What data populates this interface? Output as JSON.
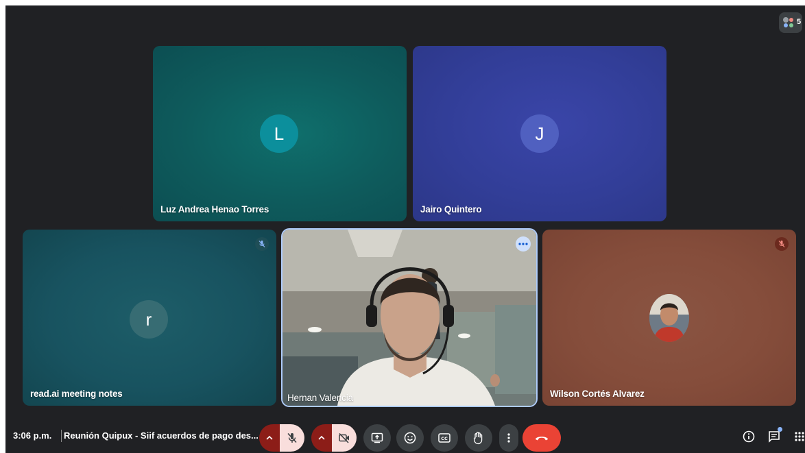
{
  "participants": {
    "count": "5",
    "tiles": [
      {
        "name": "Luz Andrea Henao Torres",
        "initial": "L"
      },
      {
        "name": "Jairo Quintero",
        "initial": "J"
      },
      {
        "name": "read.ai meeting notes",
        "initial": "r"
      },
      {
        "name": "Hernan Valencia"
      },
      {
        "name": "Wilson Cortés Alvarez"
      }
    ]
  },
  "bottom_bar": {
    "time": "3:06 p.m.",
    "meeting_title": "Reunión Quipux - Siif acuerdos de pago des..."
  },
  "colors": {
    "stage": "#202124",
    "teal_tile": "#0f5c5c",
    "blue_tile": "#33409a",
    "dark_teal_tile": "#174f5b",
    "brown_tile": "#8a4d3c",
    "end_call": "#ea4335",
    "muted_red": "#8c1d18"
  },
  "icons": {
    "participants": "people-icon",
    "mic_off": "mic-off-icon",
    "cam_off": "camera-off-icon",
    "present": "present-icon",
    "emoji": "emoji-icon",
    "captions": "captions-icon",
    "raise_hand": "hand-icon",
    "more": "more-vert-icon",
    "hangup": "phone-hangup-icon",
    "info": "info-icon",
    "chat": "chat-icon",
    "activities": "apps-grid-icon"
  }
}
